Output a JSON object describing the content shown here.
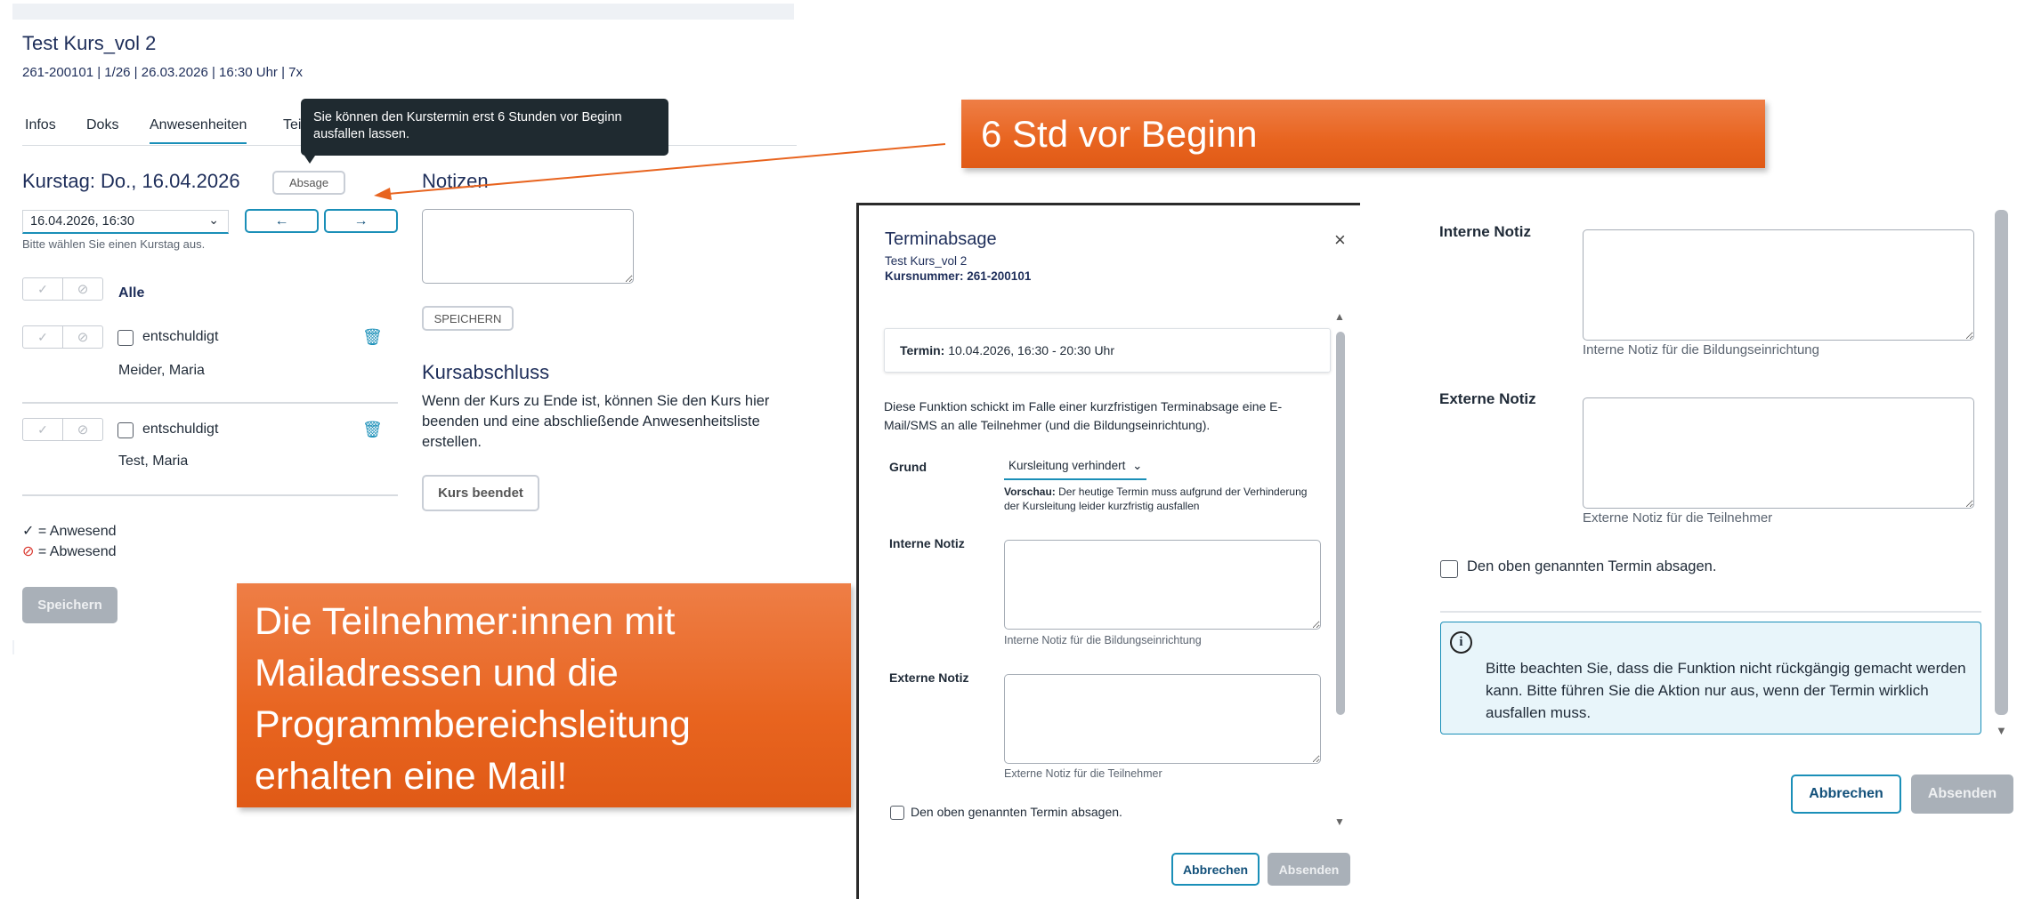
{
  "course": {
    "title": "Test Kurs_vol 2",
    "meta": "261-200101 | 1/26 | 26.03.2026 | 16:30 Uhr | 7x"
  },
  "tabs": [
    "Infos",
    "Doks",
    "Anwesenheiten",
    "Tei"
  ],
  "tooltip": "Sie können den Kurstermin erst 6 Stunden vor Beginn ausfallen lassen.",
  "attendance": {
    "heading": "Kurstag: Do., 16.04.2026",
    "absage_label": "Absage",
    "date_select": "16.04.2026, 16:30",
    "date_hint": "Bitte wählen Sie einen Kurstag aus.",
    "all_label": "Alle",
    "participants": [
      {
        "status": "entschuldigt",
        "name": "Meider, Maria"
      },
      {
        "status": "entschuldigt",
        "name": "Test, Maria"
      }
    ],
    "legend_present": "= Anwesend",
    "legend_absent": "= Abwesend",
    "save_label": "Speichern"
  },
  "notes": {
    "heading": "Notizen",
    "save_label": "SPEICHERN"
  },
  "completion": {
    "heading": "Kursabschluss",
    "text": "Wenn der Kurs zu Ende ist, können Sie den Kurs hier beenden und eine abschließende Anwesenheitsliste erstellen.",
    "button_label": "Kurs beendet"
  },
  "callouts": {
    "top": "6 Std vor Beginn",
    "bottom": "Die Teilnehmer:innen mit Mailadressen und die Programmbereichsleitung erhalten eine Mail!"
  },
  "dialog": {
    "title": "Terminabsage",
    "course": "Test Kurs_vol 2",
    "course_number": "Kursnummer: 261-200101",
    "termin_label": "Termin:",
    "termin_value": "10.04.2026, 16:30 - 20:30 Uhr",
    "description": "Diese Funktion schickt im Falle einer kurzfristigen Terminabsage eine E-Mail/SMS an alle Teilnehmer (und die Bildungseinrichtung).",
    "grund_label": "Grund",
    "grund_value": "Kursleitung verhindert",
    "preview_label": "Vorschau:",
    "preview_text": "Der heutige Termin muss aufgrund der Verhinderung der Kursleitung leider kurzfristig ausfallen",
    "internal_label": "Interne Notiz",
    "internal_hint": "Interne Notiz für die Bildungseinrichtung",
    "external_label": "Externe Notiz",
    "external_hint": "Externe Notiz für die Teilnehmer",
    "confirm_label": "Den oben genannten Termin absagen.",
    "cancel_label": "Abbrechen",
    "submit_label": "Absenden"
  },
  "zoom": {
    "internal_label": "Interne Notiz",
    "internal_hint": "Interne Notiz für die Bildungseinrichtung",
    "external_label": "Externe Notiz",
    "external_hint": "Externe Notiz für die Teilnehmer",
    "confirm_label": "Den oben genannten Termin absagen.",
    "info_text": "Bitte beachten Sie, dass die Funktion nicht rückgängig gemacht werden kann. Bitte führen Sie die Aktion nur aus, wenn der Termin wirklich ausfallen muss.",
    "cancel_label": "Abbrechen",
    "submit_label": "Absenden"
  },
  "colors": {
    "accent": "#1a8fb8",
    "navy": "#1e2e5a",
    "callout": "#e8641f",
    "info_bg": "#e8f5fa",
    "absent": "#d9342b"
  }
}
